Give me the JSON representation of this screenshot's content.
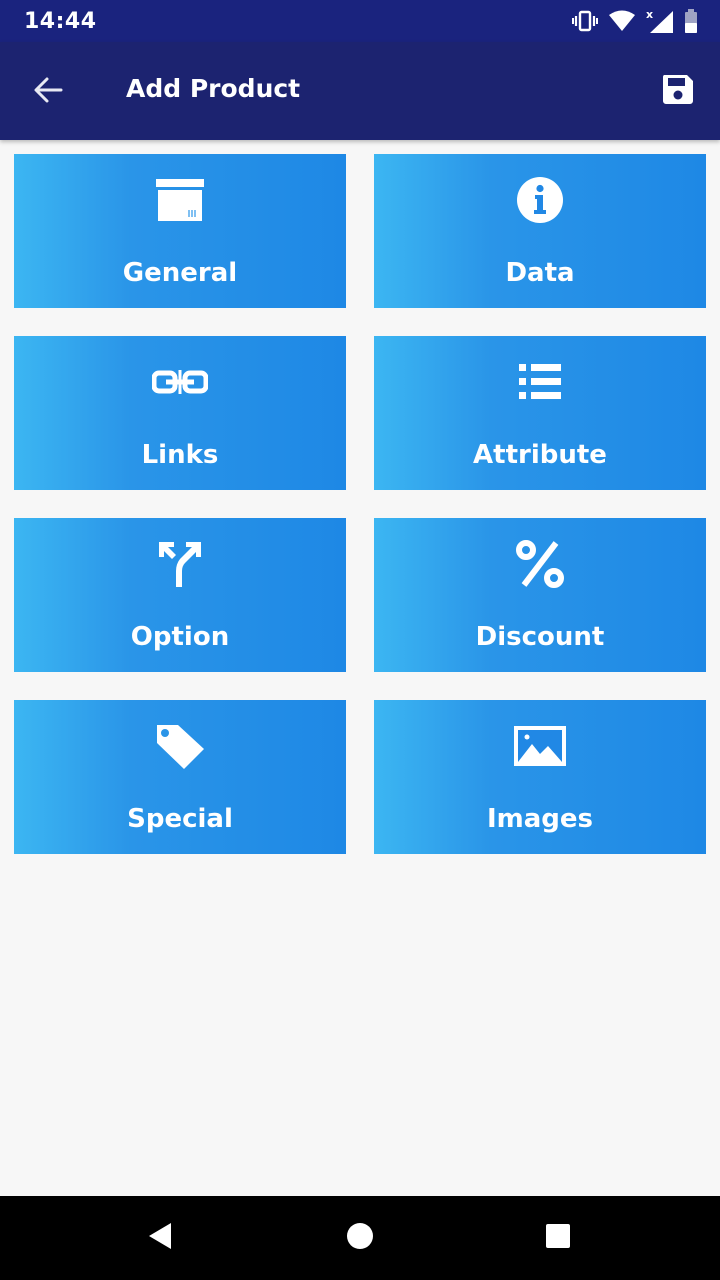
{
  "status_bar": {
    "time": "14:44",
    "icons": [
      "vibrate-icon",
      "wifi-icon",
      "signal-icon",
      "battery-icon"
    ]
  },
  "app_bar": {
    "title": "Add Product",
    "back_icon": "arrow-back-icon",
    "save_icon": "save-icon",
    "background": "#1c2370"
  },
  "tiles": [
    {
      "label": "General",
      "icon": "box-icon"
    },
    {
      "label": "Data",
      "icon": "info-icon"
    },
    {
      "label": "Links",
      "icon": "link-icon"
    },
    {
      "label": "Attribute",
      "icon": "list-icon"
    },
    {
      "label": "Option",
      "icon": "merge-arrows-icon"
    },
    {
      "label": "Discount",
      "icon": "percent-icon"
    },
    {
      "label": "Special",
      "icon": "tag-icon"
    },
    {
      "label": "Images",
      "icon": "image-icon"
    }
  ],
  "colors": {
    "tile_start": "#3cb6f2",
    "tile_end": "#1e88e5",
    "page_background": "#f7f7f7"
  },
  "nav_bar": {
    "icons": [
      "back-triangle-icon",
      "home-circle-icon",
      "recents-square-icon"
    ]
  }
}
